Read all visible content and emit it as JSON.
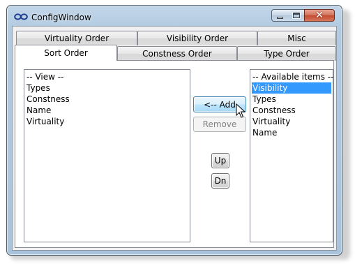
{
  "window": {
    "title": "ConfigWindow",
    "controls": {
      "minimize": "minimize",
      "maximize": "maximize",
      "close": "close"
    }
  },
  "tabs": {
    "row_back": [
      {
        "label": "Virtuality Order"
      },
      {
        "label": "Visibility Order"
      },
      {
        "label": "Misc"
      }
    ],
    "row_front": [
      {
        "label": "Sort Order",
        "selected": true
      },
      {
        "label": "Constness Order"
      },
      {
        "label": "Type Order"
      }
    ]
  },
  "sort_order": {
    "view_list": {
      "items": [
        "-- View --",
        "Types",
        "Constness",
        "Name",
        "Virtuality"
      ]
    },
    "available_list": {
      "items": [
        "-- Available items --",
        "Visibility",
        "Types",
        "Constness",
        "Virtuality",
        "Name"
      ],
      "selected_index": 1
    },
    "buttons": {
      "add": "<-- Add",
      "remove": "Remove",
      "up": "Up",
      "down": "Dn"
    }
  },
  "colors": {
    "selection": "#3399ff",
    "window_frame": "#b3cbe1",
    "close_button": "#c24a2f"
  },
  "icons": {
    "app": "infinity-icon",
    "cursor": "mouse-pointer-icon"
  }
}
